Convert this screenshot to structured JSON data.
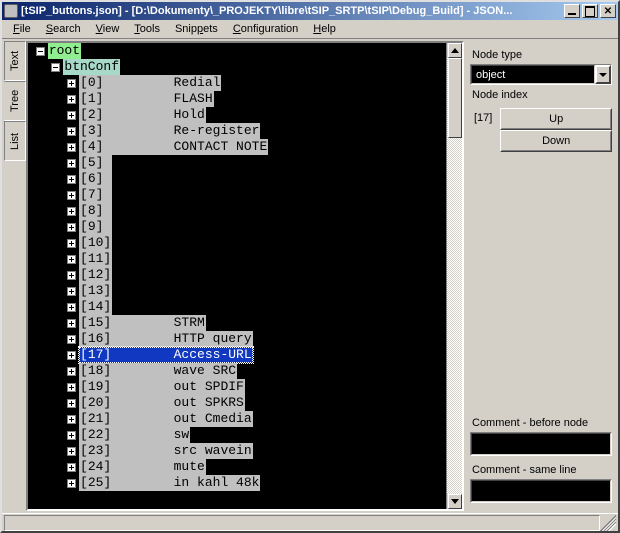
{
  "title": "[tSIP_buttons.json] - [D:\\Dokumenty\\_PROJEKTY\\libre\\tSIP_SRTP\\tSIP\\Debug_Build] - JSON...",
  "menu": [
    "File",
    "Search",
    "View",
    "Tools",
    "Snippets",
    "Configuration",
    "Help"
  ],
  "menu_underline_idx": [
    0,
    0,
    0,
    0,
    4,
    0,
    0
  ],
  "side_tabs": [
    "Text",
    "Tree",
    "List"
  ],
  "active_side_tab": 1,
  "tree": {
    "root_label": "root",
    "child_label": "btnConf",
    "selected_index": 17,
    "items": [
      {
        "key": "[0]",
        "val": "Redial"
      },
      {
        "key": "[1]",
        "val": "FLASH"
      },
      {
        "key": "[2]",
        "val": "Hold"
      },
      {
        "key": "[3]",
        "val": "Re-register"
      },
      {
        "key": "[4]",
        "val": "CONTACT NOTE"
      },
      {
        "key": "[5]",
        "val": ""
      },
      {
        "key": "[6]",
        "val": ""
      },
      {
        "key": "[7]",
        "val": ""
      },
      {
        "key": "[8]",
        "val": ""
      },
      {
        "key": "[9]",
        "val": ""
      },
      {
        "key": "[10]",
        "val": ""
      },
      {
        "key": "[11]",
        "val": ""
      },
      {
        "key": "[12]",
        "val": ""
      },
      {
        "key": "[13]",
        "val": ""
      },
      {
        "key": "[14]",
        "val": ""
      },
      {
        "key": "[15]",
        "val": "STRM"
      },
      {
        "key": "[16]",
        "val": "HTTP query"
      },
      {
        "key": "[17]",
        "val": "Access-URL"
      },
      {
        "key": "[18]",
        "val": "wave SRC"
      },
      {
        "key": "[19]",
        "val": "out SPDIF"
      },
      {
        "key": "[20]",
        "val": "out SPKRS"
      },
      {
        "key": "[21]",
        "val": "out Cmedia"
      },
      {
        "key": "[22]",
        "val": "sw"
      },
      {
        "key": "[23]",
        "val": "src wavein"
      },
      {
        "key": "[24]",
        "val": "mute"
      },
      {
        "key": "[25]",
        "val": "in kahl 48k"
      }
    ]
  },
  "right": {
    "node_type_label": "Node type",
    "node_type_value": "object",
    "node_index_label": "Node index",
    "node_index_value": "[17]",
    "up_label": "Up",
    "down_label": "Down",
    "comment_before_label": "Comment - before node",
    "comment_same_label": "Comment - same line",
    "comment_before_value": "",
    "comment_same_value": ""
  }
}
